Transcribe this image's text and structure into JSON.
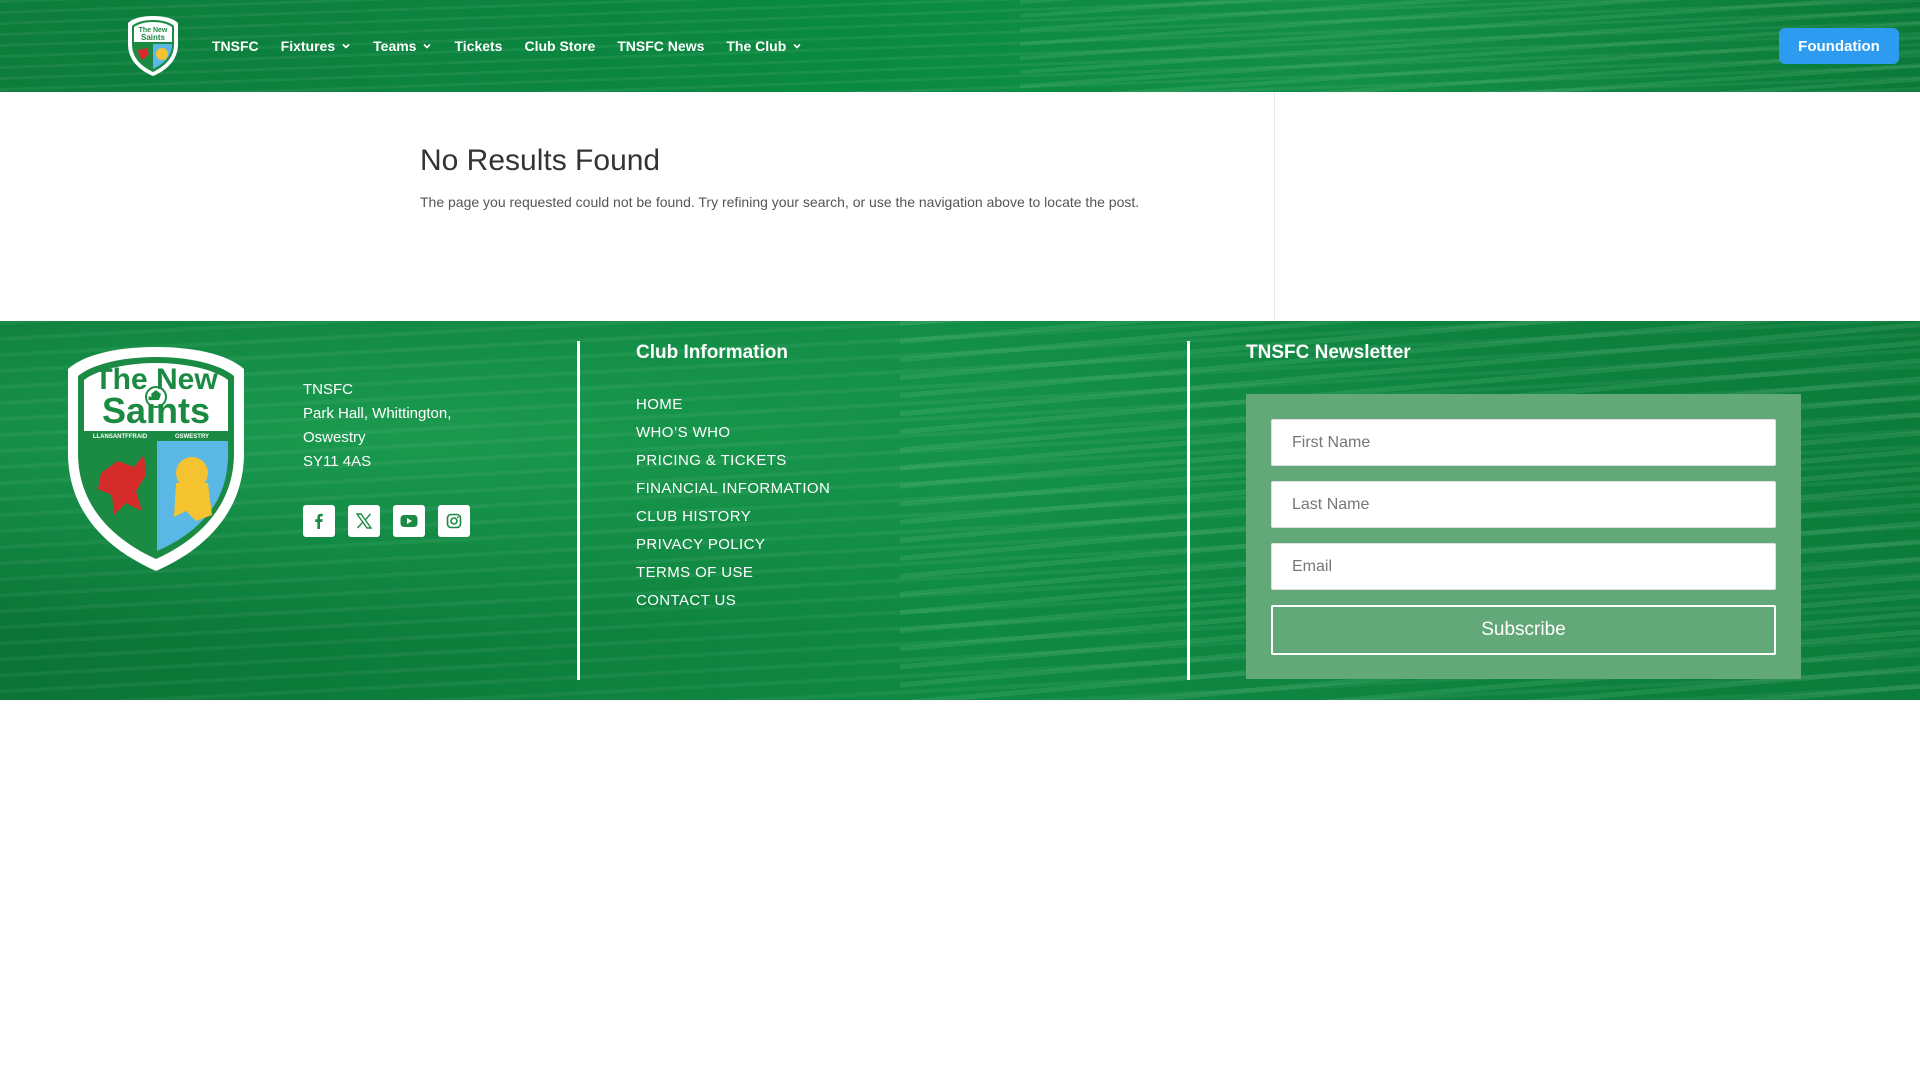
{
  "header": {
    "nav": [
      {
        "label": "TNSFC",
        "has_dropdown": false
      },
      {
        "label": "Fixtures",
        "has_dropdown": true
      },
      {
        "label": "Teams",
        "has_dropdown": true
      },
      {
        "label": "Tickets",
        "has_dropdown": false
      },
      {
        "label": "Club Store",
        "has_dropdown": false
      },
      {
        "label": "TNSFC News",
        "has_dropdown": false
      },
      {
        "label": "The Club",
        "has_dropdown": true
      }
    ],
    "cta_label": "Foundation"
  },
  "main": {
    "title": "No Results Found",
    "message": "The page you requested could not be found. Try refining your search, or use the navigation above to locate the post."
  },
  "footer": {
    "logo": {
      "line1": "The New",
      "line2": "Saints",
      "left_place": "LLANSANTFFRAID",
      "right_place": "OSWESTRY"
    },
    "address": [
      "TNSFC",
      "Park Hall, Whittington,",
      "Oswestry",
      "SY11 4AS"
    ],
    "socials": [
      "facebook-icon",
      "x-icon",
      "youtube-icon",
      "instagram-icon"
    ],
    "club_info": {
      "title": "Club Information",
      "links": [
        "HOME",
        "WHO’S WHO",
        "PRICING & TICKETS",
        "FINANCIAL INFORMATION",
        "CLUB HISTORY",
        "PRIVACY POLICY",
        "TERMS OF USE",
        "CONTACT US"
      ]
    },
    "newsletter": {
      "title": "TNSFC Newsletter",
      "first_name_placeholder": "First Name",
      "last_name_placeholder": "Last Name",
      "email_placeholder": "Email",
      "subscribe_label": "Subscribe"
    }
  },
  "colors": {
    "brand_green": "#0a8a41",
    "cta_blue": "#2d9cf0",
    "newsletter_box": "#63a878"
  }
}
